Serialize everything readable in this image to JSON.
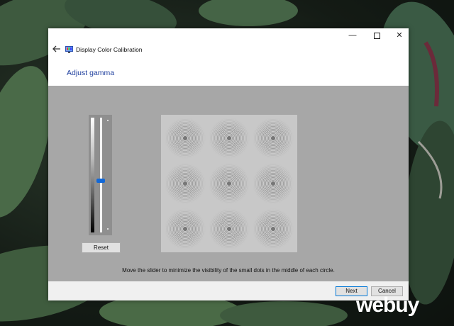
{
  "window": {
    "app_title": "Display Color Calibration",
    "controls": {
      "minimize": "—",
      "maximize": "",
      "close": "✕"
    }
  },
  "page": {
    "heading": "Adjust gamma",
    "instruction": "Move the slider to minimize the visibility of the small dots in the middle of each circle."
  },
  "slider": {
    "value_fraction": 0.55,
    "reset_label": "Reset"
  },
  "footer": {
    "next_label": "Next",
    "cancel_label": "Cancel"
  },
  "watermark": {
    "text": "webuy"
  },
  "colors": {
    "accent": "#1168d8",
    "heading": "#1f3f9e",
    "content_bg": "#a7a7a7"
  },
  "icons": {
    "back": "arrow-left-icon",
    "app": "display-calibration-icon"
  }
}
